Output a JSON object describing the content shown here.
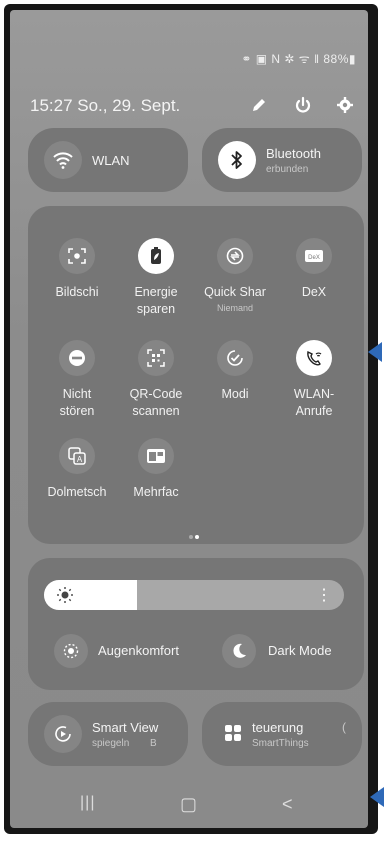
{
  "status_bar": {
    "icons_text": "⚭ ▣ N ✲ ᯤ ‖ 88%▮",
    "battery": "88%"
  },
  "header": {
    "time_date": "15:27 So., 29. Sept.",
    "icons": [
      "pencil-icon",
      "power-icon",
      "gear-icon"
    ]
  },
  "top_tiles": {
    "wlan": {
      "label": "WLAN"
    },
    "bluetooth": {
      "label": "Bluetooth",
      "sublabel": "erbunden"
    }
  },
  "grid": [
    {
      "label": "Bildschi",
      "sub": "",
      "icon": "screen-record-icon",
      "active": false
    },
    {
      "label": "Energie\nsparen",
      "sub": "",
      "icon": "battery-leaf-icon",
      "active": true
    },
    {
      "label": "Quick Shar",
      "sub": "Niemand",
      "icon": "quick-share-icon",
      "active": false
    },
    {
      "label": "DeX",
      "sub": "",
      "icon": "dex-icon",
      "active": false
    },
    {
      "label": "Nicht\nstören",
      "sub": "",
      "icon": "do-not-disturb-icon",
      "active": false
    },
    {
      "label": "QR-Code\nscannen",
      "sub": "",
      "icon": "qr-scan-icon",
      "active": false
    },
    {
      "label": "Modi",
      "sub": "",
      "icon": "modes-icon",
      "active": false
    },
    {
      "label": "WLAN-\nAnrufe",
      "sub": "",
      "icon": "wifi-calling-icon",
      "active": true
    },
    {
      "label": "Dolmetsch",
      "sub": "",
      "icon": "interpreter-icon",
      "active": false
    },
    {
      "label": "Mehrfac",
      "sub": "",
      "icon": "multi-window-icon",
      "active": false
    }
  ],
  "pagination": {
    "pages": 2,
    "current": 2
  },
  "brightness": {
    "level": 0.31,
    "more_glyph": "⋮"
  },
  "eye_comfort": {
    "label": "Augenkomfort"
  },
  "dark_mode": {
    "label": "Dark Mode"
  },
  "smart_view": {
    "label": "Smart View",
    "sub": "spiegeln",
    "sub_extra": "B"
  },
  "smartthings": {
    "label": "teuerung",
    "sub": "SmartThings",
    "edge": "("
  },
  "navbar": {
    "recents": "|||",
    "home": "▢",
    "back": "<"
  },
  "colors": {
    "annotation_arrow": "#2e69b8"
  }
}
